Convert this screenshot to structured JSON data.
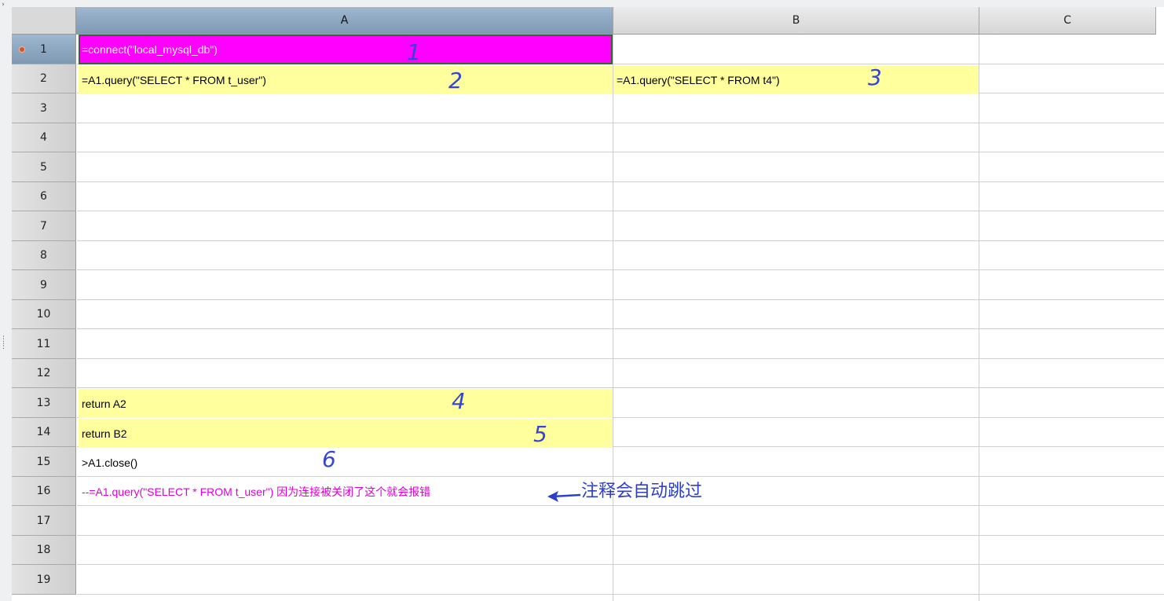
{
  "columns": [
    "A",
    "B",
    "C"
  ],
  "rows": [
    "1",
    "2",
    "3",
    "4",
    "5",
    "6",
    "7",
    "8",
    "9",
    "10",
    "11",
    "12",
    "13",
    "14",
    "15",
    "16",
    "17",
    "18",
    "19"
  ],
  "cells": {
    "A1": "=connect(\"local_mysql_db\")",
    "A2": "=A1.query(\"SELECT * FROM t_user\")",
    "B2": "=A1.query(\"SELECT * FROM t4\")",
    "A13": "return A2",
    "A14": "return B2",
    "A15": ">A1.close()",
    "A16": "--=A1.query(\"SELECT * FROM t_user\") 因为连接被关闭了这个就会报错"
  },
  "annotations": {
    "step1": "1",
    "step2": "2",
    "step3": "3",
    "step4": "4",
    "step5": "5",
    "step6": "6",
    "comment_note": "注释会自动跳过"
  },
  "colors": {
    "cell_highlight_yellow": "#ffff9e",
    "cell_selected_magenta": "#ff00ff",
    "comment_text": "#e000d8",
    "annotation_blue": "#3246d2",
    "header_active": "#8fa8c2"
  }
}
